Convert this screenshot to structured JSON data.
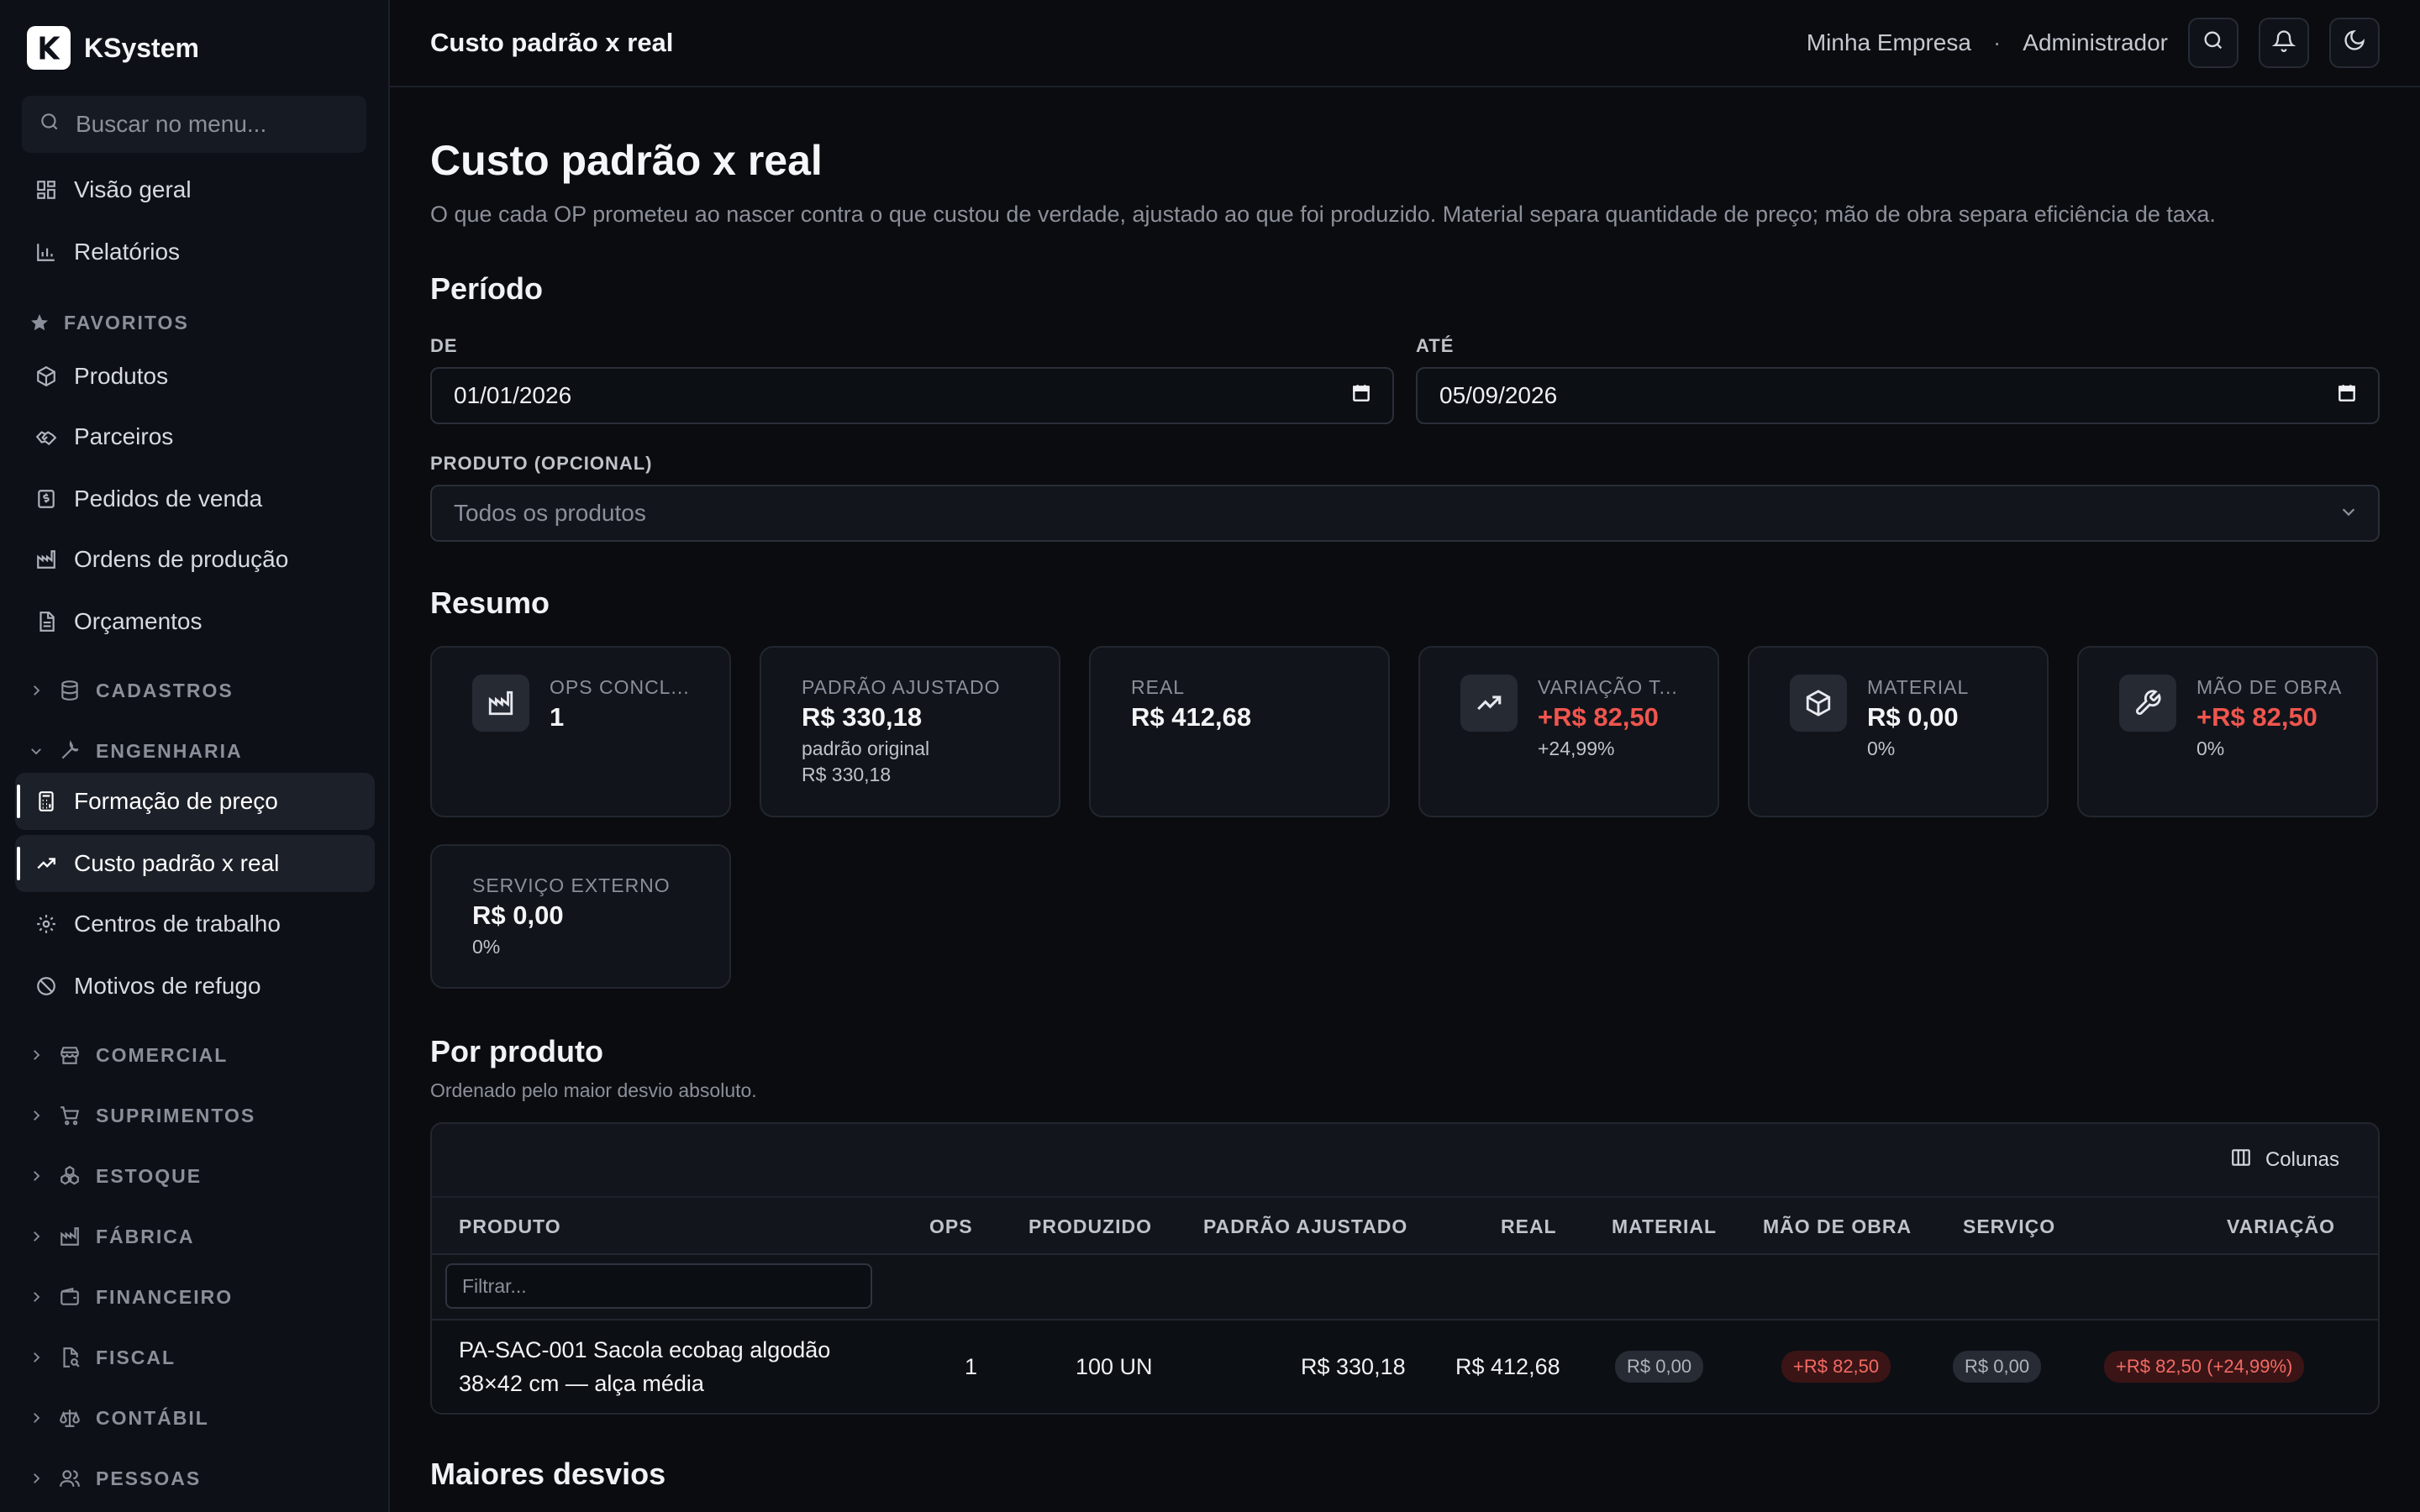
{
  "brand": {
    "name": "KSystem"
  },
  "sidebar": {
    "search_placeholder": "Buscar no menu...",
    "top_items": [
      {
        "label": "Visão geral",
        "icon": "dashboard-icon"
      },
      {
        "label": "Relatórios",
        "icon": "bar-chart-icon"
      }
    ],
    "favorites_label": "FAVORITOS",
    "favorites": [
      {
        "label": "Produtos",
        "icon": "package-icon"
      },
      {
        "label": "Parceiros",
        "icon": "handshake-icon"
      },
      {
        "label": "Pedidos de venda",
        "icon": "dollar-receipt-icon"
      },
      {
        "label": "Ordens de produção",
        "icon": "factory-icon"
      },
      {
        "label": "Orçamentos",
        "icon": "document-icon"
      }
    ],
    "groups": {
      "cadastros": "CADASTROS",
      "engenharia": "ENGENHARIA",
      "comercial": "COMERCIAL",
      "suprimentos": "SUPRIMENTOS",
      "estoque": "ESTOQUE",
      "fabrica": "FÁBRICA",
      "financeiro": "FINANCEIRO",
      "fiscal": "FISCAL",
      "contabil": "CONTÁBIL",
      "pessoas": "PESSOAS"
    },
    "engenharia_items": [
      {
        "label": "Formação de preço",
        "icon": "calculator-icon",
        "active": true
      },
      {
        "label": "Custo padrão x real",
        "icon": "trending-up-icon",
        "active": true
      },
      {
        "label": "Centros de trabalho",
        "icon": "gear-icon",
        "active": false
      },
      {
        "label": "Motivos de refugo",
        "icon": "ban-icon",
        "active": false
      }
    ]
  },
  "topbar": {
    "title": "Custo padrão x real",
    "company": "Minha Empresa",
    "separator": "·",
    "user": "Administrador"
  },
  "page": {
    "title": "Custo padrão x real",
    "description": "O que cada OP prometeu ao nascer contra o que custou de verdade, ajustado ao que foi produzido. Material separa quantidade de preço; mão de obra separa eficiência de taxa."
  },
  "periodo": {
    "title": "Período",
    "from_label": "DE",
    "from_value": "01/01/2026",
    "to_label": "ATÉ",
    "to_value": "05/09/2026",
    "product_label": "PRODUTO (OPCIONAL)",
    "product_value": "Todos os produtos"
  },
  "resumo": {
    "title": "Resumo",
    "cards": [
      {
        "label": "OPS CONCL...",
        "value": "1",
        "icon": "factory-icon"
      },
      {
        "label": "PADRÃO AJUSTADO",
        "value": "R$ 330,18",
        "sub1": "padrão original",
        "sub2": "R$ 330,18"
      },
      {
        "label": "REAL",
        "value": "R$ 412,68"
      },
      {
        "label": "VARIAÇÃO T...",
        "value": "+R$ 82,50",
        "sub1": "+24,99%",
        "icon": "trending-up-icon"
      },
      {
        "label": "MATERIAL",
        "value": "R$ 0,00",
        "sub1": "0%",
        "icon": "box-icon"
      },
      {
        "label": "MÃO DE OBRA",
        "value": "+R$ 82,50",
        "sub1": "0%",
        "icon": "wrench-icon"
      },
      {
        "label": "SERVIÇO EXTERNO",
        "value": "R$ 0,00",
        "sub1": "0%"
      }
    ]
  },
  "por_produto": {
    "title": "Por produto",
    "subtitle": "Ordenado pelo maior desvio absoluto.",
    "columns_button": "Colunas",
    "headers": {
      "produto": "PRODUTO",
      "ops": "OPS",
      "produzido": "PRODUZIDO",
      "padrao": "PADRÃO AJUSTADO",
      "real": "REAL",
      "material": "MATERIAL",
      "mao": "MÃO DE OBRA",
      "servico": "SERVIÇO",
      "variacao": "VARIAÇÃO"
    },
    "filter_placeholder": "Filtrar...",
    "rows": [
      {
        "produto_l1": "PA-SAC-001 Sacola ecobag algodão",
        "produto_l2": "38×42 cm — alça média",
        "ops": "1",
        "produzido": "100 UN",
        "padrao": "R$ 330,18",
        "real": "R$ 412,68",
        "material": "R$ 0,00",
        "mao": "+R$ 82,50",
        "servico": "R$ 0,00",
        "variacao": "+R$ 82,50 (+24,99%)"
      }
    ]
  },
  "maiores_desvios": {
    "title": "Maiores desvios"
  },
  "colors": {
    "danger": "#f0554e",
    "background": "#0a0c10",
    "sidebar": "#0d1016"
  }
}
